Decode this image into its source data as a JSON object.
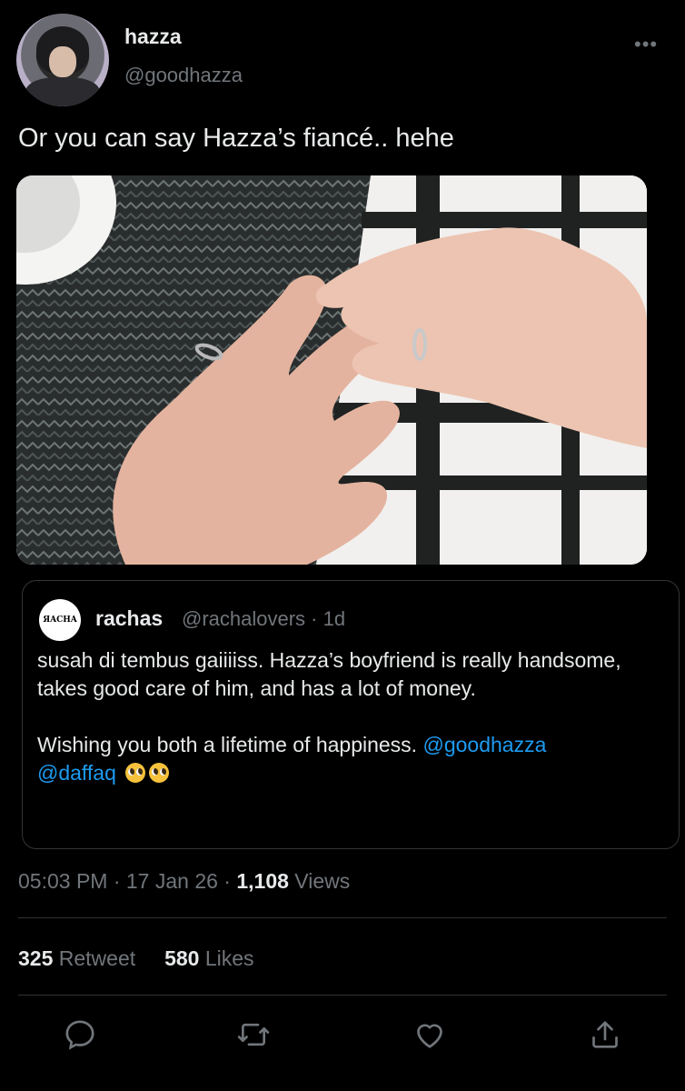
{
  "tweet": {
    "author_name": "hazza",
    "author_handle": "@goodhazza",
    "more_icon": "•••",
    "text": "Or you can say Hazza’s fiancé.. hehe",
    "photo_icon": "photo-of-hands-with-rings"
  },
  "quote": {
    "avatar_text": "ЯACHA",
    "author_name": "rachas",
    "meta": "@rachalovers · 1d",
    "para1": "susah di tembus gaiiiiss. Hazza’s boyfriend is really handsome, takes good care of him, and has a lot of money.",
    "para2_text": "Wishing you both a lifetime of happiness. ",
    "mention1": "@goodhazza",
    "mention2": "@daffaq"
  },
  "meta": {
    "time": "05:03 PM · 17 Jan 26 · ",
    "views_count": "1,108",
    "views_label": " Views"
  },
  "stats": {
    "retweet_count": "325",
    "retweet_label": " Retweet",
    "likes_count": "580",
    "likes_label": " Likes"
  },
  "colors": {
    "background": "#000000",
    "text": "#e7e9ea",
    "secondary": "#71767b",
    "link": "#1d9bf0"
  }
}
